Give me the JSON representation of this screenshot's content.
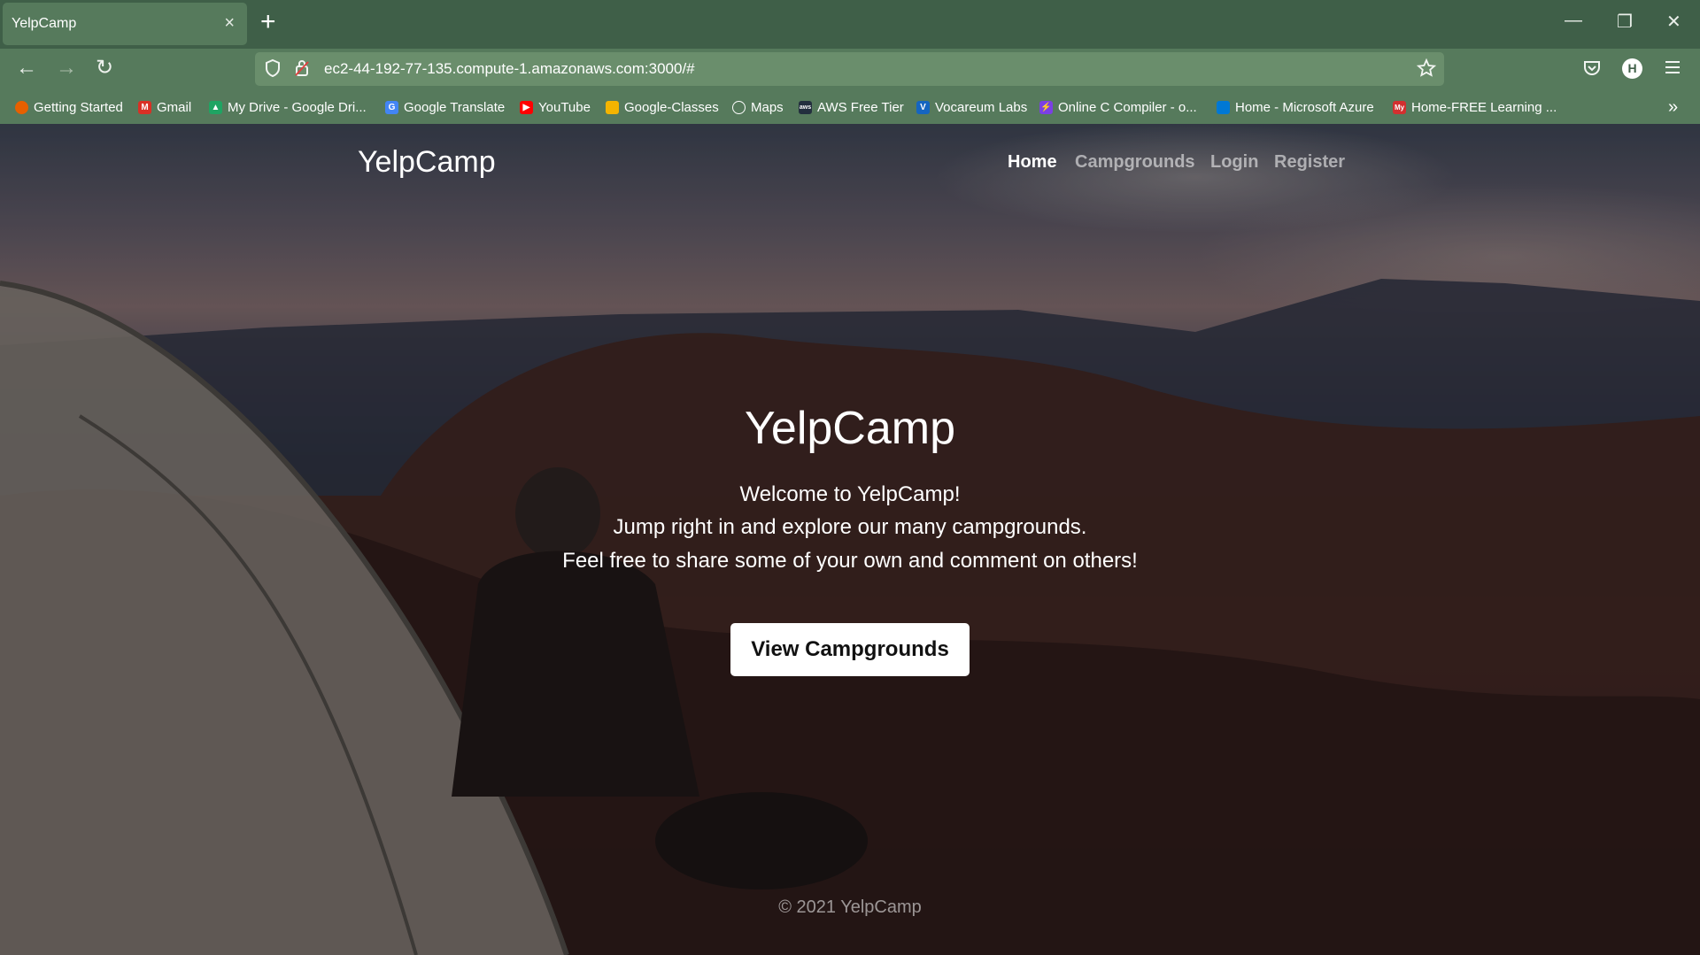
{
  "browser": {
    "tab_title": "YelpCamp",
    "tab_close": "×",
    "new_tab": "+",
    "url": "ec2-44-192-77-135.compute-1.amazonaws.com:3000/#",
    "window_controls": {
      "minimize": "—",
      "restore": "❐",
      "close": "✕"
    },
    "nav": {
      "back": "←",
      "forward": "→",
      "reload": "↻"
    },
    "avatar_initial": "H",
    "bookmarks": [
      {
        "label": "Getting Started",
        "icon": "firefox-icon",
        "color": "#e66000"
      },
      {
        "label": "Gmail",
        "icon": "gmail-icon",
        "color": "#d93025"
      },
      {
        "label": "My Drive - Google Dri...",
        "icon": "drive-icon",
        "color": "#1fa463"
      },
      {
        "label": "Google Translate",
        "icon": "translate-icon",
        "color": "#4285f4"
      },
      {
        "label": "YouTube",
        "icon": "youtube-icon",
        "color": "#ff0000"
      },
      {
        "label": "Google-Classes",
        "icon": "classroom-icon",
        "color": "#f4b400"
      },
      {
        "label": "Maps",
        "icon": "globe-icon",
        "color": "#567a5c"
      },
      {
        "label": "AWS Free Tier",
        "icon": "aws-icon",
        "color": "#232f3e"
      },
      {
        "label": "Vocareum Labs",
        "icon": "vocareum-icon",
        "color": "#1565c0"
      },
      {
        "label": "Online C Compiler - o...",
        "icon": "compiler-icon",
        "color": "#7b3fe4"
      },
      {
        "label": "Home - Microsoft Azure",
        "icon": "azure-icon",
        "color": "#0078d4"
      },
      {
        "label": "Home-FREE Learning ...",
        "icon": "learning-icon",
        "color": "#d32f2f"
      }
    ],
    "bookmarks_overflow": "»"
  },
  "page": {
    "brand": "YelpCamp",
    "nav": {
      "home": "Home",
      "campgrounds": "Campgrounds",
      "login": "Login",
      "register": "Register"
    },
    "hero": {
      "title": "YelpCamp",
      "line1": "Welcome to YelpCamp!",
      "line2": "Jump right in and explore our many campgrounds.",
      "line3": "Feel free to share some of your own and comment on others!",
      "cta": "View Campgrounds"
    },
    "footer": "© 2021 YelpCamp"
  }
}
